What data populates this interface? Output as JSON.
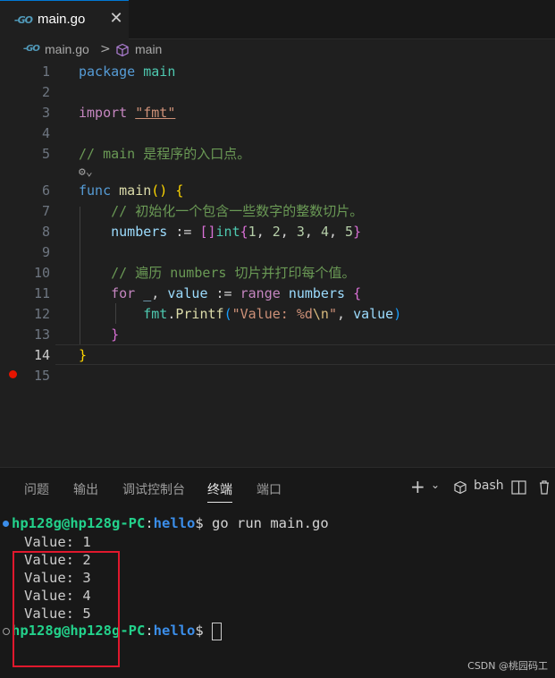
{
  "tab": {
    "icon": "go-file-icon",
    "icon_glyph": "-GO",
    "label": "main.go",
    "close_glyph": "✕"
  },
  "breadcrumb": {
    "file": "main.go",
    "separator": ">",
    "symbol": "main"
  },
  "editor": {
    "line_numbers": [
      "1",
      "2",
      "3",
      "4",
      "5",
      "6",
      "7",
      "8",
      "9",
      "10",
      "11",
      "12",
      "13",
      "14",
      "15"
    ],
    "active_line": "14",
    "tokens": {
      "l1_kw": "package",
      "l1_name": "main",
      "l3_kw": "import",
      "l3_str": "\"fmt\"",
      "l5_comment": "// main 是程序的入口点。",
      "codelens_glyph": "⚙⌄",
      "l6_kw": "func",
      "l6_name": "main",
      "l6_paren": "()",
      "l6_brace": "{",
      "l7_comment": "// 初始化一个包含一些数字的整数切片。",
      "l8_var": "numbers",
      "l8_op": ":=",
      "l8_brk": "[]",
      "l8_type": "int",
      "l8_lb": "{",
      "l8_nums": [
        "1",
        "2",
        "3",
        "4",
        "5"
      ],
      "l8_sep": ", ",
      "l8_rb": "}",
      "l10_comment": "// 遍历 numbers 切片并打印每个值。",
      "l11_for": "for",
      "l11_blank": "_",
      "l11_comma": ",",
      "l11_value": "value",
      "l11_op": ":=",
      "l11_range": "range",
      "l11_numbers": "numbers",
      "l11_brace": "{",
      "l12_pkg": "fmt",
      "l12_dot": ".",
      "l12_func": "Printf",
      "l12_lp": "(",
      "l12_str_a": "\"Value: %d",
      "l12_esc": "\\n",
      "l12_str_b": "\"",
      "l12_comma": ",",
      "l12_value": "value",
      "l12_rp": ")",
      "l13_brace": "}",
      "l14_brace": "}"
    }
  },
  "panel": {
    "tabs": [
      "问题",
      "输出",
      "调试控制台",
      "终端",
      "端口"
    ],
    "active_tab": "终端",
    "controls": {
      "add": "+",
      "add_dropdown": "⌄",
      "shell_icon": "terminal-shell-icon",
      "shell": "bash",
      "split_glyph": "◫",
      "trash_glyph": "🗑"
    }
  },
  "terminal": {
    "prompt_user": "hp128g@hp128g-PC",
    "prompt_colon": ":",
    "prompt_dir": "hello",
    "prompt_suffix": "$",
    "command": "go run main.go",
    "output": [
      "Value: 1",
      "Value: 2",
      "Value: 3",
      "Value: 4",
      "Value: 5"
    ]
  },
  "watermark": "CSDN @桃园码工",
  "colors": {
    "editor_bg": "#1f1f1f",
    "keyword": "#569cd6",
    "control": "#c586c0",
    "string": "#ce9178",
    "comment": "#6a9955",
    "function": "#dcdcaa",
    "variable": "#9cdcfe",
    "number": "#b5cea8",
    "type": "#4ec9b0",
    "prompt_user": "#23d18b",
    "prompt_dir": "#3b8eea",
    "highlight_box": "#e0182d",
    "breakpoint": "#e51400"
  }
}
